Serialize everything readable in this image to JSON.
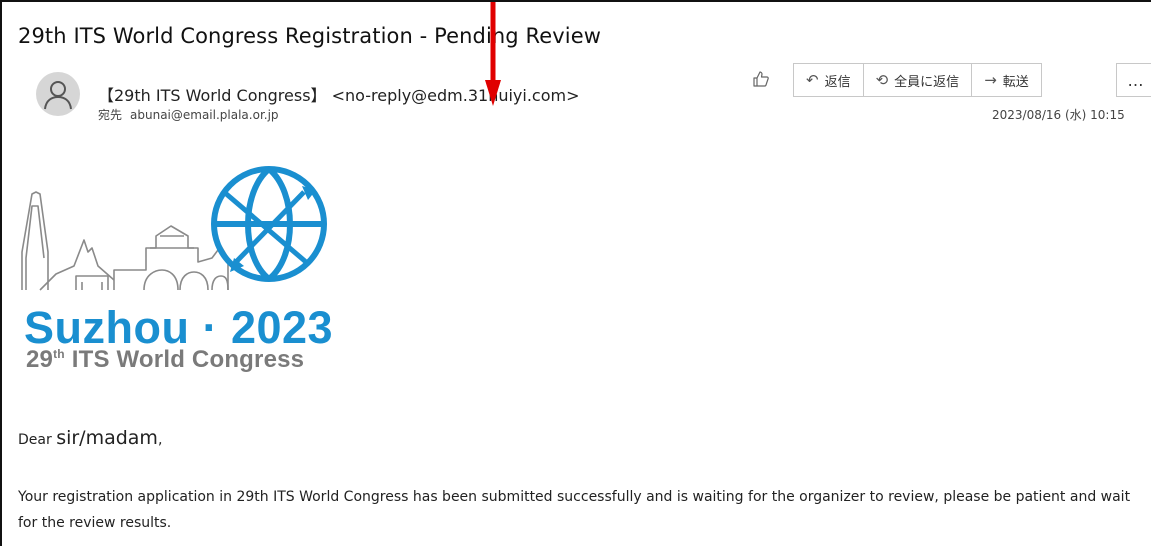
{
  "email": {
    "subject": "29th ITS World Congress Registration - Pending Review",
    "sender": "【29th ITS World Congress】 <no-reply@edm.31huiyi.com>",
    "recipient_label": "宛先",
    "recipient": "abunai@email.plala.or.jp",
    "datetime": "2023/08/16 (水) 10:15"
  },
  "toolbar": {
    "like_icon": "thumbs-up-icon",
    "reply_label": "返信",
    "reply_all_label": "全員に返信",
    "forward_label": "転送",
    "more_label": "…"
  },
  "logo": {
    "city": "Suzhou · 2023",
    "congress_num": "29",
    "congress_sup": "th",
    "congress_rest": " ITS World Congress"
  },
  "body": {
    "greeting_prefix": "Dear ",
    "greeting_name": "sir/madam",
    "greeting_suffix": ",",
    "paragraph": "Your registration application in 29th ITS World Congress has been submitted successfully and is waiting for the organizer to review, please be patient and wait for the review results."
  },
  "colors": {
    "annotation_arrow": "#e00000",
    "logo_blue": "#1a8fd0",
    "logo_gray": "#7a7a7a"
  }
}
